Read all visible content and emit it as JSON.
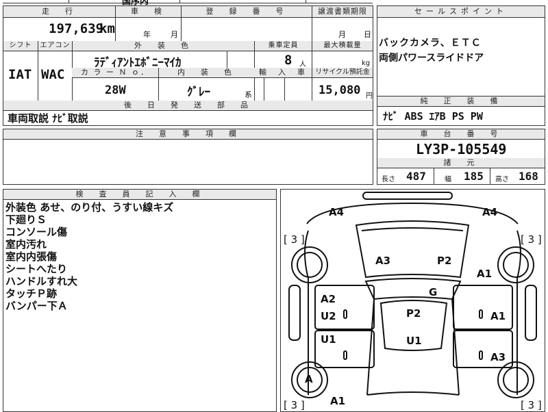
{
  "top_strip": {
    "partial": "国序内"
  },
  "mileage": {
    "header": "走　行",
    "value": "197,639",
    "unit": "km"
  },
  "inspection": {
    "header": "車　検",
    "year_unit": "年",
    "month_unit": "月"
  },
  "registration": {
    "header": "登　録　番　号"
  },
  "transfer": {
    "header": "譲渡書類期限",
    "month_unit": "月",
    "day_unit": "日"
  },
  "sales_point": {
    "header": "セールスポイント",
    "lines": [
      "バックカメラ、ＥＴＣ",
      "両側パワースライドドア"
    ]
  },
  "shift": {
    "header": "シフト",
    "value": "IAT"
  },
  "aircon": {
    "header": "エアコン",
    "value": "WAC"
  },
  "exterior_color": {
    "header": "外　装　色",
    "value": "ﾗﾃﾞｨｱﾝﾄｴﾎﾞﾆｰﾏｲｶ"
  },
  "capacity": {
    "header": "乗車定員",
    "value": "8",
    "unit": "人"
  },
  "max_load": {
    "header": "最大積載量",
    "unit": "kg"
  },
  "color_no": {
    "header": "カ ラ ー Ｎ ｏ．",
    "value": "28W"
  },
  "interior_color": {
    "header": "内　装　色",
    "value": "ｸﾞﾚｰ",
    "suffix": "系"
  },
  "import_car": {
    "header": "輸　入　車"
  },
  "recycle": {
    "header": "リサイクル預託金",
    "value": "15,080",
    "unit": "円"
  },
  "later_parts": {
    "header": "後　日　発　送　部　品",
    "value": "車両取説 ﾅﾋﾞ取説"
  },
  "genuine_equipment": {
    "header": "純　正　装　備",
    "value": "ﾅﾋﾞ ABS ｴｱB PS PW"
  },
  "notes": {
    "header": "注　意　事　項　欄"
  },
  "chassis": {
    "header": "車　台　番　号",
    "value": "LY3P-105549"
  },
  "specs": {
    "header": "諸　元",
    "length_label": "長さ",
    "length": "487",
    "width_label": "幅",
    "width": "185",
    "height_label": "高さ",
    "height": "168"
  },
  "inspector": {
    "header": "検　査　員　記　入　欄",
    "lines": [
      "外装色 あせ、のり付、うすい線キズ",
      "下廻りＳ",
      "コンソール傷",
      "室内汚れ",
      "室内内張傷",
      "シートへたり",
      "ハンドルすれ大",
      "タッチＰ跡",
      "バンパー下Ａ"
    ]
  },
  "diagram": {
    "tire_labels": [
      "[ 3 ]",
      "[ 3 ]",
      "[ 3 ]",
      "[ 3 ]"
    ],
    "damage": {
      "front_left": "A4",
      "front_right": "A4",
      "hood_left": "A3",
      "hood_right": "P2",
      "fender_right": "A1",
      "windshield": "G",
      "door_left_front_top": "A2",
      "door_left_front_bottom": "U2",
      "roof": "P2",
      "door_right_front": "A1",
      "door_left_rear": "U1",
      "roof_rear": "U1",
      "door_right_rear": "A3",
      "rear_left_wheel": "A",
      "rear_left": "A1"
    }
  }
}
